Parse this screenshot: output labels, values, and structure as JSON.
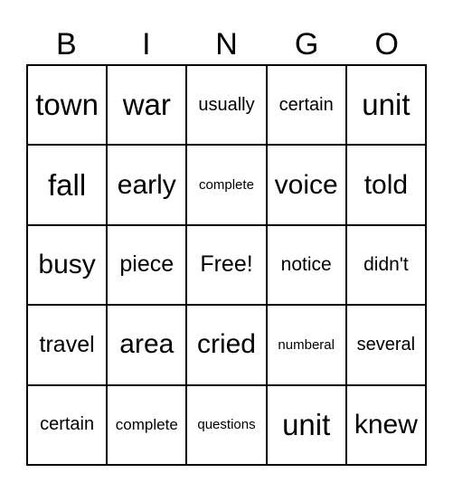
{
  "header": [
    "B",
    "I",
    "N",
    "G",
    "O"
  ],
  "cells": [
    "town",
    "war",
    "usually",
    "certain",
    "unit",
    "fall",
    "early",
    "complete",
    "voice",
    "told",
    "busy",
    "piece",
    "Free!",
    "notice",
    "didn't",
    "travel",
    "area",
    "cried",
    "numberal",
    "several",
    "certain",
    "complete",
    "questions",
    "unit",
    "knew"
  ]
}
